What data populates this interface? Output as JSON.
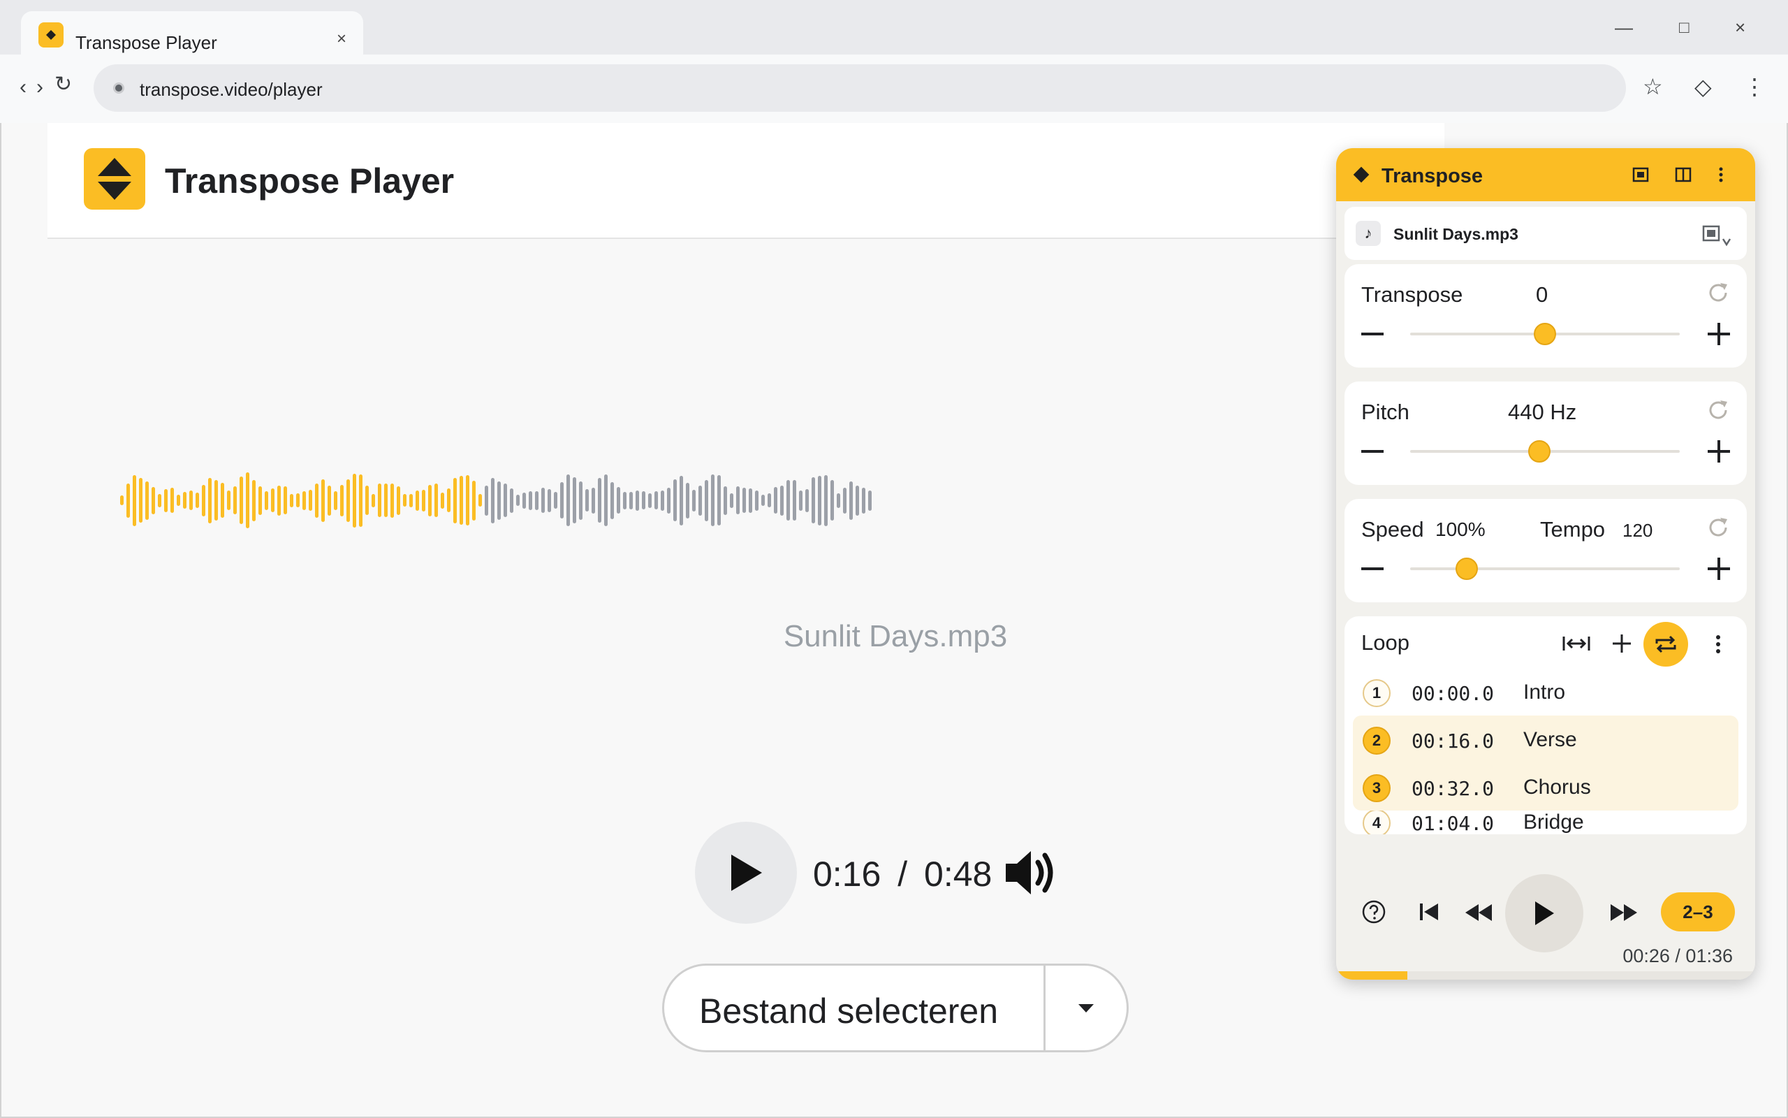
{
  "browser": {
    "tab_title": "Transpose Player",
    "tab_close": "×",
    "window_controls": {
      "minimize": "—",
      "maximize": "□",
      "close": "×"
    },
    "nav": {
      "back": "‹",
      "forward": "›",
      "reload": "↻"
    },
    "url": "transpose.video/player",
    "toolbar_icons": {
      "bookmark": "☆",
      "extension": "◇",
      "menu": "⋮"
    }
  },
  "app": {
    "title": "Transpose Player",
    "file_name": "Sunlit Days.mp3",
    "current_time": "0:16",
    "time_separator": "/",
    "duration": "0:48",
    "select_button": "Bestand selecteren",
    "waveform_progress": 0.48
  },
  "panel": {
    "title": "Transpose",
    "file_card": {
      "icon": "music-note-icon",
      "file_name": "Sunlit Days.mp3"
    },
    "transpose": {
      "label": "Transpose",
      "value": "0",
      "slider_fraction": 0.5
    },
    "pitch": {
      "label": "Pitch",
      "value": "440 Hz",
      "slider_fraction": 0.48
    },
    "speed": {
      "label": "Speed",
      "value": "100%",
      "tempo_label": "Tempo",
      "tempo_value": "120",
      "slider_fraction": 0.21
    },
    "loop": {
      "label": "Loop",
      "items": [
        {
          "num": "1",
          "time": "00:00.0",
          "name": "Intro",
          "selected": false
        },
        {
          "num": "2",
          "time": "00:16.0",
          "name": "Verse",
          "selected": true
        },
        {
          "num": "3",
          "time": "00:32.0",
          "name": "Chorus",
          "selected": true
        },
        {
          "num": "4",
          "time": "01:04.0",
          "name": "Bridge",
          "selected": false
        }
      ]
    },
    "transport": {
      "range": "2–3",
      "current_time": "00:26",
      "total_time": "01:36",
      "time_text": "00:26 / 01:36",
      "progress_fraction": 0.17
    }
  },
  "colors": {
    "accent": "#fbbd24",
    "played_wave": "#fbbd24",
    "unplayed_wave": "#9ca0a8",
    "selected_row": "#fcf4e0"
  }
}
